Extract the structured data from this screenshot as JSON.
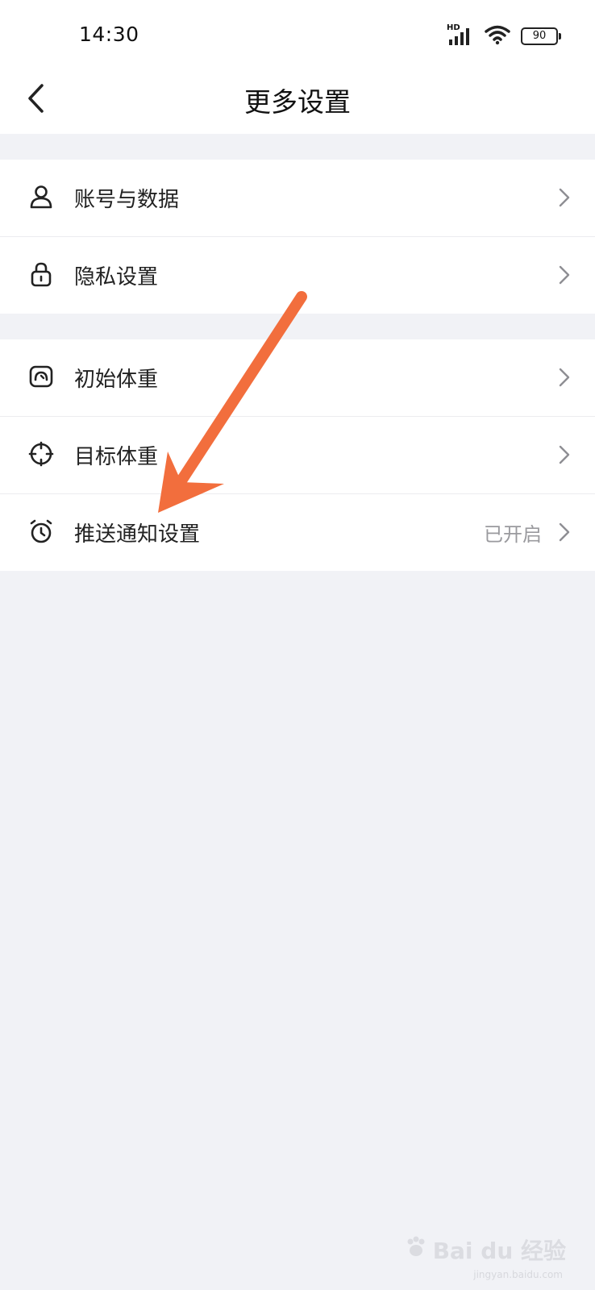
{
  "status_bar": {
    "time": "14:30",
    "network_label": "HD",
    "battery": "90"
  },
  "header": {
    "title": "更多设置",
    "back_icon": "chevron-left-icon"
  },
  "groups": [
    {
      "items": [
        {
          "label": "账号与数据",
          "icon": "user-icon",
          "value": ""
        },
        {
          "label": "隐私设置",
          "icon": "lock-icon",
          "value": ""
        }
      ]
    },
    {
      "items": [
        {
          "label": "初始体重",
          "icon": "scale-icon",
          "value": ""
        },
        {
          "label": "目标体重",
          "icon": "target-icon",
          "value": ""
        },
        {
          "label": "推送通知设置",
          "icon": "alarm-clock-icon",
          "value": "已开启"
        }
      ]
    }
  ],
  "annotation": {
    "arrow_color": "#f26e3d"
  },
  "watermark": {
    "brand": "Bai du 经验",
    "url": "jingyan.baidu.com"
  },
  "colors": {
    "background": "#f1f2f6",
    "card": "#ffffff",
    "secondary_text": "#9a9a9e"
  }
}
